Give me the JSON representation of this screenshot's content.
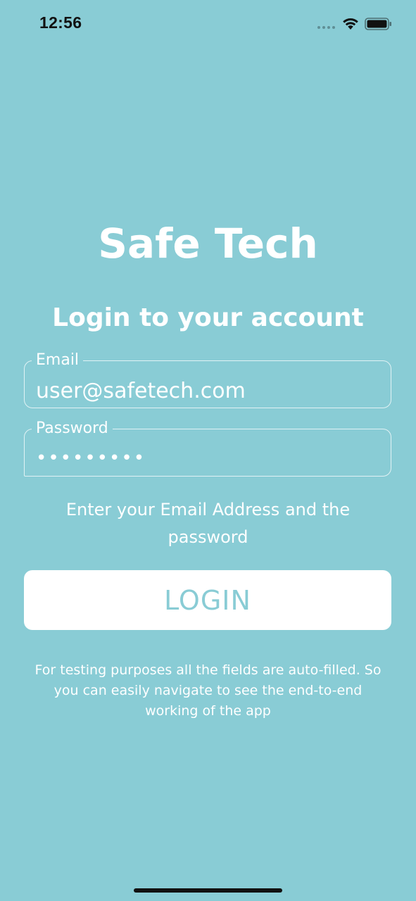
{
  "status_bar": {
    "time": "12:56",
    "icons": [
      "signal-dots-icon",
      "wifi-icon",
      "battery-icon"
    ]
  },
  "app": {
    "title": "Safe Tech",
    "subtitle": "Login to your account"
  },
  "form": {
    "email": {
      "label": "Email",
      "value": "user@safetech.com"
    },
    "password": {
      "label": "Password",
      "value": "•••••••••"
    },
    "hint": "Enter your Email Address and the password",
    "login_label": "LOGIN",
    "note": "For testing purposes all the fields are auto-filled. So you can easily navigate to see the end-to-end working of the app"
  },
  "colors": {
    "background": "#89ccd5",
    "text": "#ffffff",
    "button_bg": "#ffffff",
    "button_text": "#89ccd5"
  }
}
